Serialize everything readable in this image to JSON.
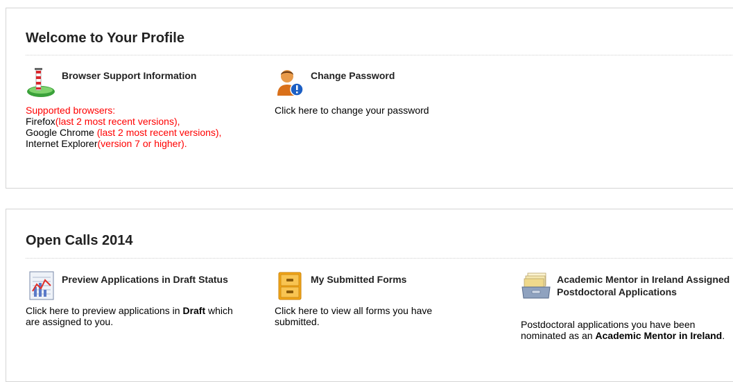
{
  "profile": {
    "title": "Welcome to Your Profile",
    "browser_support": {
      "heading": "Browser Support Information",
      "supported_label": "Supported browsers:",
      "firefox_name": "Firefox",
      "firefox_note": "(last 2 most recent versions),",
      "chrome_name": "Google Chrome ",
      "chrome_note": "(last 2 most recent versions),",
      "ie_name": "Internet Explorer",
      "ie_note": "(version 7 or higher)."
    },
    "change_password": {
      "heading": "Change Password",
      "body": "Click here to change your password"
    }
  },
  "open_calls": {
    "title": "Open Calls 2014",
    "preview": {
      "heading": "Preview Applications in Draft Status",
      "body_before": "Click here to preview applications in ",
      "body_bold": "Draft",
      "body_after": " which are assigned to you."
    },
    "submitted": {
      "heading": "My Submitted Forms",
      "body": "Click here to view all forms you have submitted."
    },
    "mentor": {
      "heading": "Academic Mentor in Ireland Assigned Postdoctoral Applications",
      "body_before": "Postdoctoral applications you have been nominated as an ",
      "body_bold": "Academic Mentor in Ireland",
      "body_after": "."
    }
  },
  "colors": {
    "accent_red": "#ff0000",
    "heading": "#222222",
    "border": "#d4d4d4"
  },
  "icons": {
    "browser_support": "pole-on-globe-icon",
    "change_password": "user-info-icon",
    "preview": "chart-document-icon",
    "submitted": "folder-icon",
    "mentor": "file-tray-icon"
  }
}
